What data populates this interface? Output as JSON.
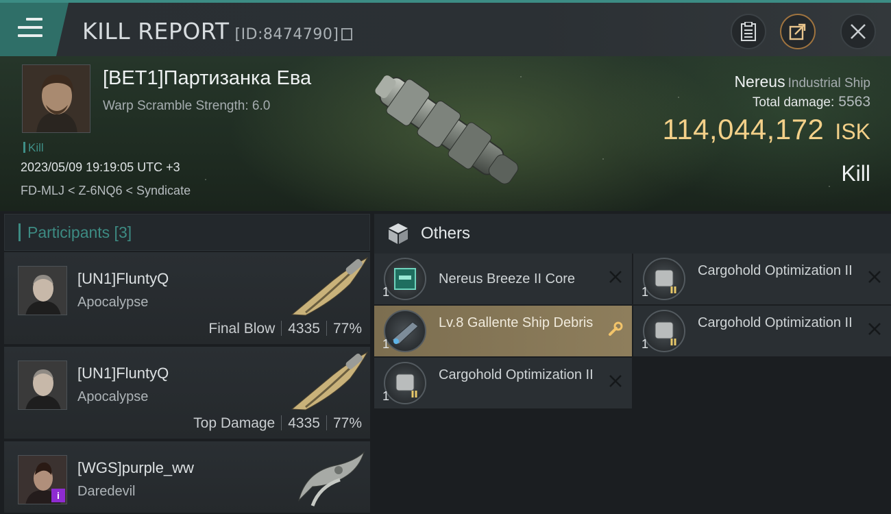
{
  "header": {
    "title": "KILL REPORT",
    "id_label": "[ID:8474790]"
  },
  "victim": {
    "name": "[BET1]Партизанка Ева",
    "warp_scramble": "Warp Scramble Strength: 6.0",
    "kill_tag": "Kill",
    "timestamp": "2023/05/09 19:19:05 UTC +3",
    "location": "FD-MLJ < Z-6NQ6 < Syndicate",
    "ship_name": "Nereus",
    "ship_class": "Industrial Ship",
    "total_damage_label": "Total damage:",
    "total_damage": "5563",
    "isk_value": "114,044,172",
    "isk_unit": "ISK",
    "result_label": "Kill"
  },
  "participants": {
    "header": "Participants [3]",
    "rows": [
      {
        "name": "[UN1]FluntyQ",
        "ship": "Apocalypse",
        "role": "Final Blow",
        "damage": "4335",
        "percent": "77%"
      },
      {
        "name": "[UN1]FluntyQ",
        "ship": "Apocalypse",
        "role": "Top Damage",
        "damage": "4335",
        "percent": "77%"
      },
      {
        "name": "[WGS]purple_ww",
        "ship": "Daredevil"
      }
    ]
  },
  "others": {
    "header": "Others",
    "items": [
      {
        "qty": "1",
        "name": "Nereus Breeze II Core"
      },
      {
        "qty": "1",
        "name": "Cargohold Optimization II"
      },
      {
        "qty": "1",
        "name": "Lv.8 Gallente Ship Debris"
      },
      {
        "qty": "1",
        "name": "Cargohold Optimization II"
      },
      {
        "qty": "1",
        "name": "Cargohold Optimization II"
      }
    ]
  },
  "colors": {
    "accent_teal": "#3d8b83",
    "isk_gold": "#f3d089",
    "highlight_item": "#8e7e5c"
  }
}
